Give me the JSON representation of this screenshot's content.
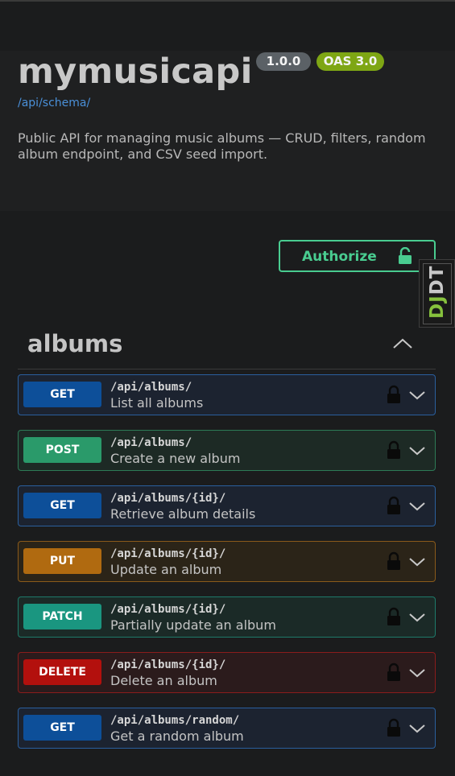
{
  "info": {
    "title": "mymusicapi",
    "version": "1.0.0",
    "oas_badge": "OAS 3.0",
    "schema_link": "/api/schema/",
    "description": "Public API for managing music albums — CRUD, filters, random album endpoint, and CSV seed import."
  },
  "authorize": {
    "label": "Authorize",
    "icon": "unlock-icon"
  },
  "djdt": {
    "dj": "DJ",
    "dt": "DT"
  },
  "section": {
    "title": "albums",
    "icon": "chevron-up-icon"
  },
  "operations": [
    {
      "method": "GET",
      "path": "/api/albums/",
      "summary": "List all albums"
    },
    {
      "method": "POST",
      "path": "/api/albums/",
      "summary": "Create a new album"
    },
    {
      "method": "GET",
      "path": "/api/albums/{id}/",
      "summary": "Retrieve album details"
    },
    {
      "method": "PUT",
      "path": "/api/albums/{id}/",
      "summary": "Update an album"
    },
    {
      "method": "PATCH",
      "path": "/api/albums/{id}/",
      "summary": "Partially update an album"
    },
    {
      "method": "DELETE",
      "path": "/api/albums/{id}/",
      "summary": "Delete an album"
    },
    {
      "method": "GET",
      "path": "/api/albums/random/",
      "summary": "Get a random album"
    }
  ],
  "colors": {
    "get": "#0d4f99",
    "post": "#2a9a6a",
    "put": "#b06a10",
    "patch": "#1a9680",
    "delete": "#b3100d",
    "authorize": "#49cc90",
    "oas_badge": "#7ea614",
    "version_badge": "#5b6166"
  }
}
